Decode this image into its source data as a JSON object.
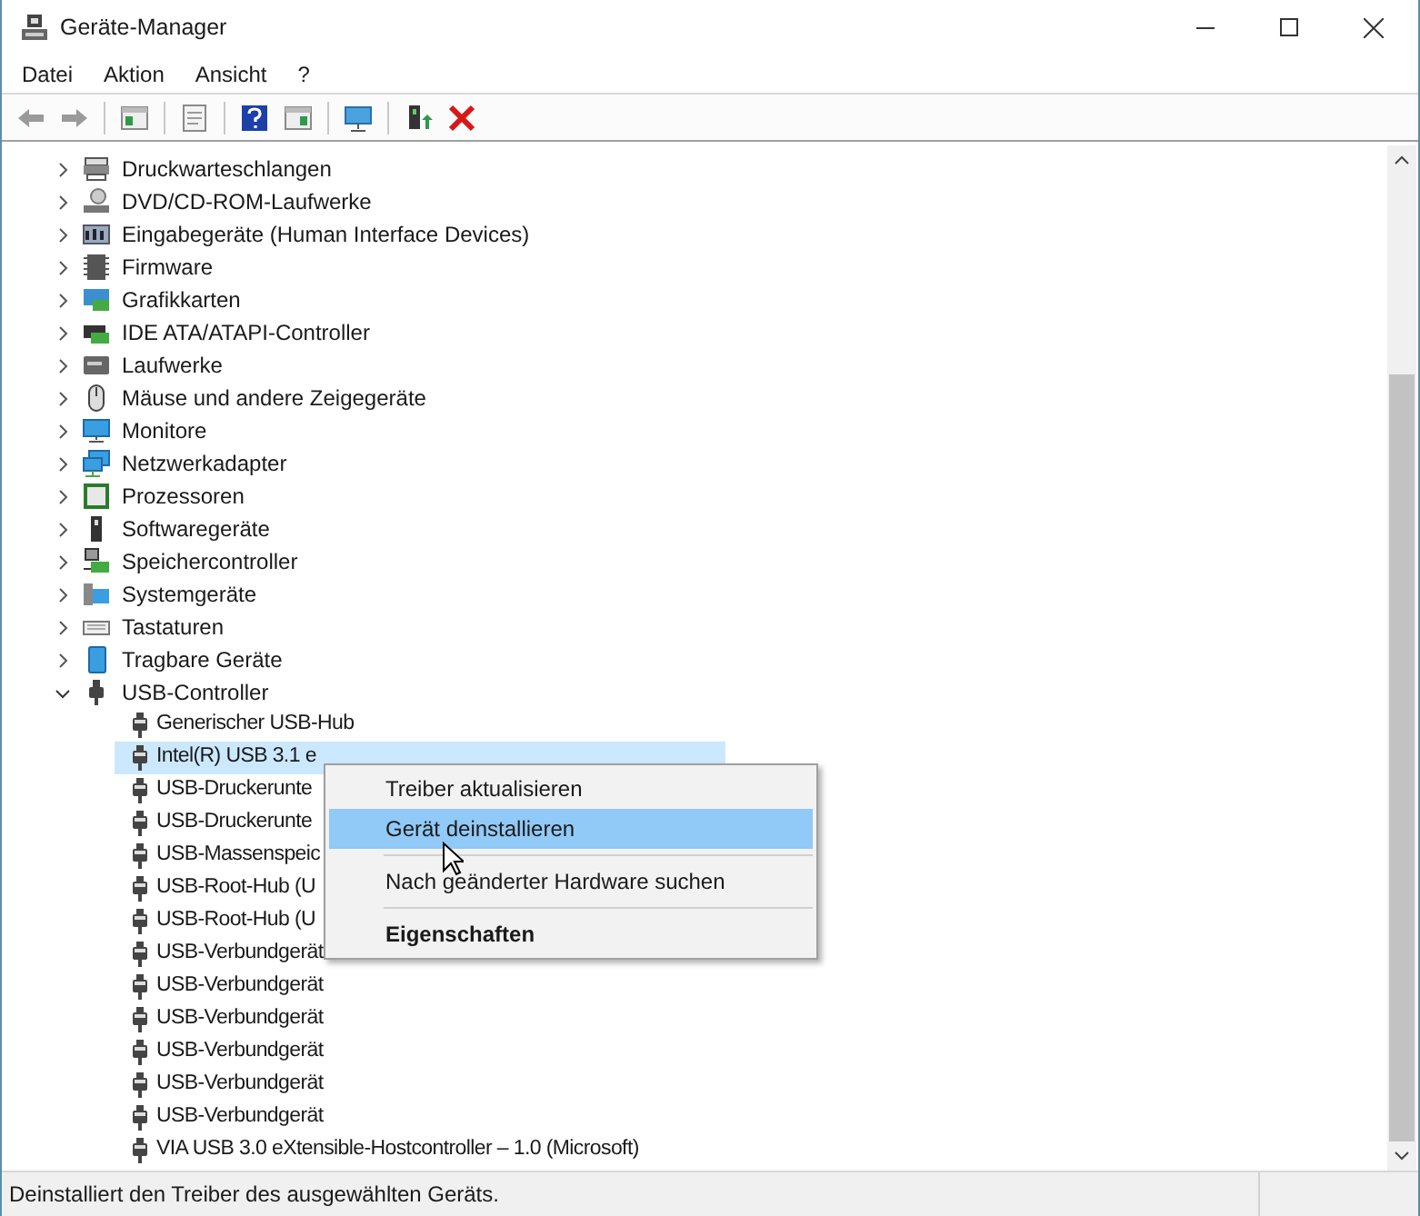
{
  "window": {
    "title": "Geräte-Manager"
  },
  "menu_bar": [
    "Datei",
    "Aktion",
    "Ansicht",
    "?"
  ],
  "tree": [
    {
      "label": "Druckwarteschlangen",
      "expanded": false
    },
    {
      "label": "DVD/CD-ROM-Laufwerke",
      "expanded": false
    },
    {
      "label": "Eingabegeräte (Human Interface Devices)",
      "expanded": false
    },
    {
      "label": "Firmware",
      "expanded": false
    },
    {
      "label": "Grafikkarten",
      "expanded": false
    },
    {
      "label": "IDE ATA/ATAPI-Controller",
      "expanded": false
    },
    {
      "label": "Laufwerke",
      "expanded": false
    },
    {
      "label": "Mäuse und andere Zeigegeräte",
      "expanded": false
    },
    {
      "label": "Monitore",
      "expanded": false
    },
    {
      "label": "Netzwerkadapter",
      "expanded": false
    },
    {
      "label": "Prozessoren",
      "expanded": false
    },
    {
      "label": "Softwaregeräte",
      "expanded": false
    },
    {
      "label": "Speichercontroller",
      "expanded": false
    },
    {
      "label": "Systemgeräte",
      "expanded": false
    },
    {
      "label": "Tastaturen",
      "expanded": false
    },
    {
      "label": "Tragbare Geräte",
      "expanded": false
    },
    {
      "label": "USB-Controller",
      "expanded": true,
      "children": [
        {
          "label": "Generischer USB-Hub",
          "selected": false
        },
        {
          "label": "Intel(R) USB 3.1 e",
          "selected": true
        },
        {
          "label": "USB-Druckerunte",
          "selected": false
        },
        {
          "label": "USB-Druckerunte",
          "selected": false
        },
        {
          "label": "USB-Massenspeic",
          "selected": false
        },
        {
          "label": "USB-Root-Hub (U",
          "selected": false
        },
        {
          "label": "USB-Root-Hub (U",
          "selected": false
        },
        {
          "label": "USB-Verbundgerät",
          "selected": false
        },
        {
          "label": "USB-Verbundgerät",
          "selected": false
        },
        {
          "label": "USB-Verbundgerät",
          "selected": false
        },
        {
          "label": "USB-Verbundgerät",
          "selected": false
        },
        {
          "label": "USB-Verbundgerät",
          "selected": false
        },
        {
          "label": "USB-Verbundgerät",
          "selected": false
        },
        {
          "label": "VIA USB 3.0 eXtensible-Hostcontroller – 1.0 (Microsoft)",
          "selected": false
        }
      ]
    }
  ],
  "context_menu": [
    {
      "kind": "item",
      "label": "Treiber aktualisieren",
      "selected": false,
      "default": false
    },
    {
      "kind": "item",
      "label": "Gerät deinstallieren",
      "selected": true,
      "default": false
    },
    {
      "kind": "separator"
    },
    {
      "kind": "item",
      "label": "Nach geänderter Hardware suchen",
      "selected": false,
      "default": false
    },
    {
      "kind": "separator"
    },
    {
      "kind": "item",
      "label": "Eigenschaften",
      "selected": false,
      "default": true
    }
  ],
  "status_bar": "Deinstalliert den Treiber des ausgewählten Geräts."
}
